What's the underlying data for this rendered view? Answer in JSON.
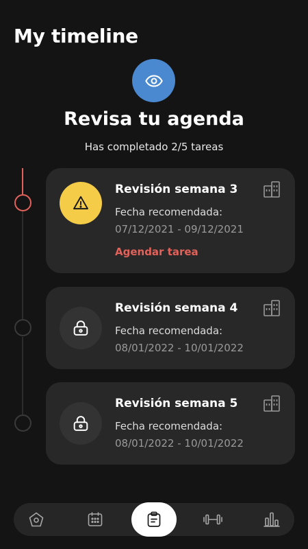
{
  "header": {
    "title": "My timeline"
  },
  "hero": {
    "icon": "eye-icon",
    "title": "Revisa tu agenda",
    "subtitle": "Has completado 2/5 tareas"
  },
  "cards": [
    {
      "title": "Revisión semana 3",
      "date_label": "Fecha recomendada:",
      "dates": "07/12/2021 - 09/12/2021",
      "action": "Agendar tarea",
      "status_icon": "warning-icon",
      "building_icon": "building-icon"
    },
    {
      "title": "Revisión semana 4",
      "date_label": "Fecha recomendada:",
      "dates": "08/01/2022 - 10/01/2022",
      "status_icon": "lock-icon",
      "building_icon": "building-icon"
    },
    {
      "title": "Revisión semana 5",
      "date_label": "Fecha recomendada:",
      "dates": "08/01/2022 - 10/01/2022",
      "status_icon": "lock-icon",
      "building_icon": "building-icon"
    }
  ],
  "bottom_nav": {
    "items": [
      {
        "icon": "home-icon"
      },
      {
        "icon": "calendar-icon"
      },
      {
        "icon": "clipboard-icon",
        "active": true
      },
      {
        "icon": "dumbbell-icon"
      },
      {
        "icon": "bar-chart-icon"
      }
    ]
  },
  "colors": {
    "background": "#141414",
    "card": "#282828",
    "accent": "#e0625a",
    "warning": "#f5cc47",
    "hero_blue": "#4a88cf"
  }
}
